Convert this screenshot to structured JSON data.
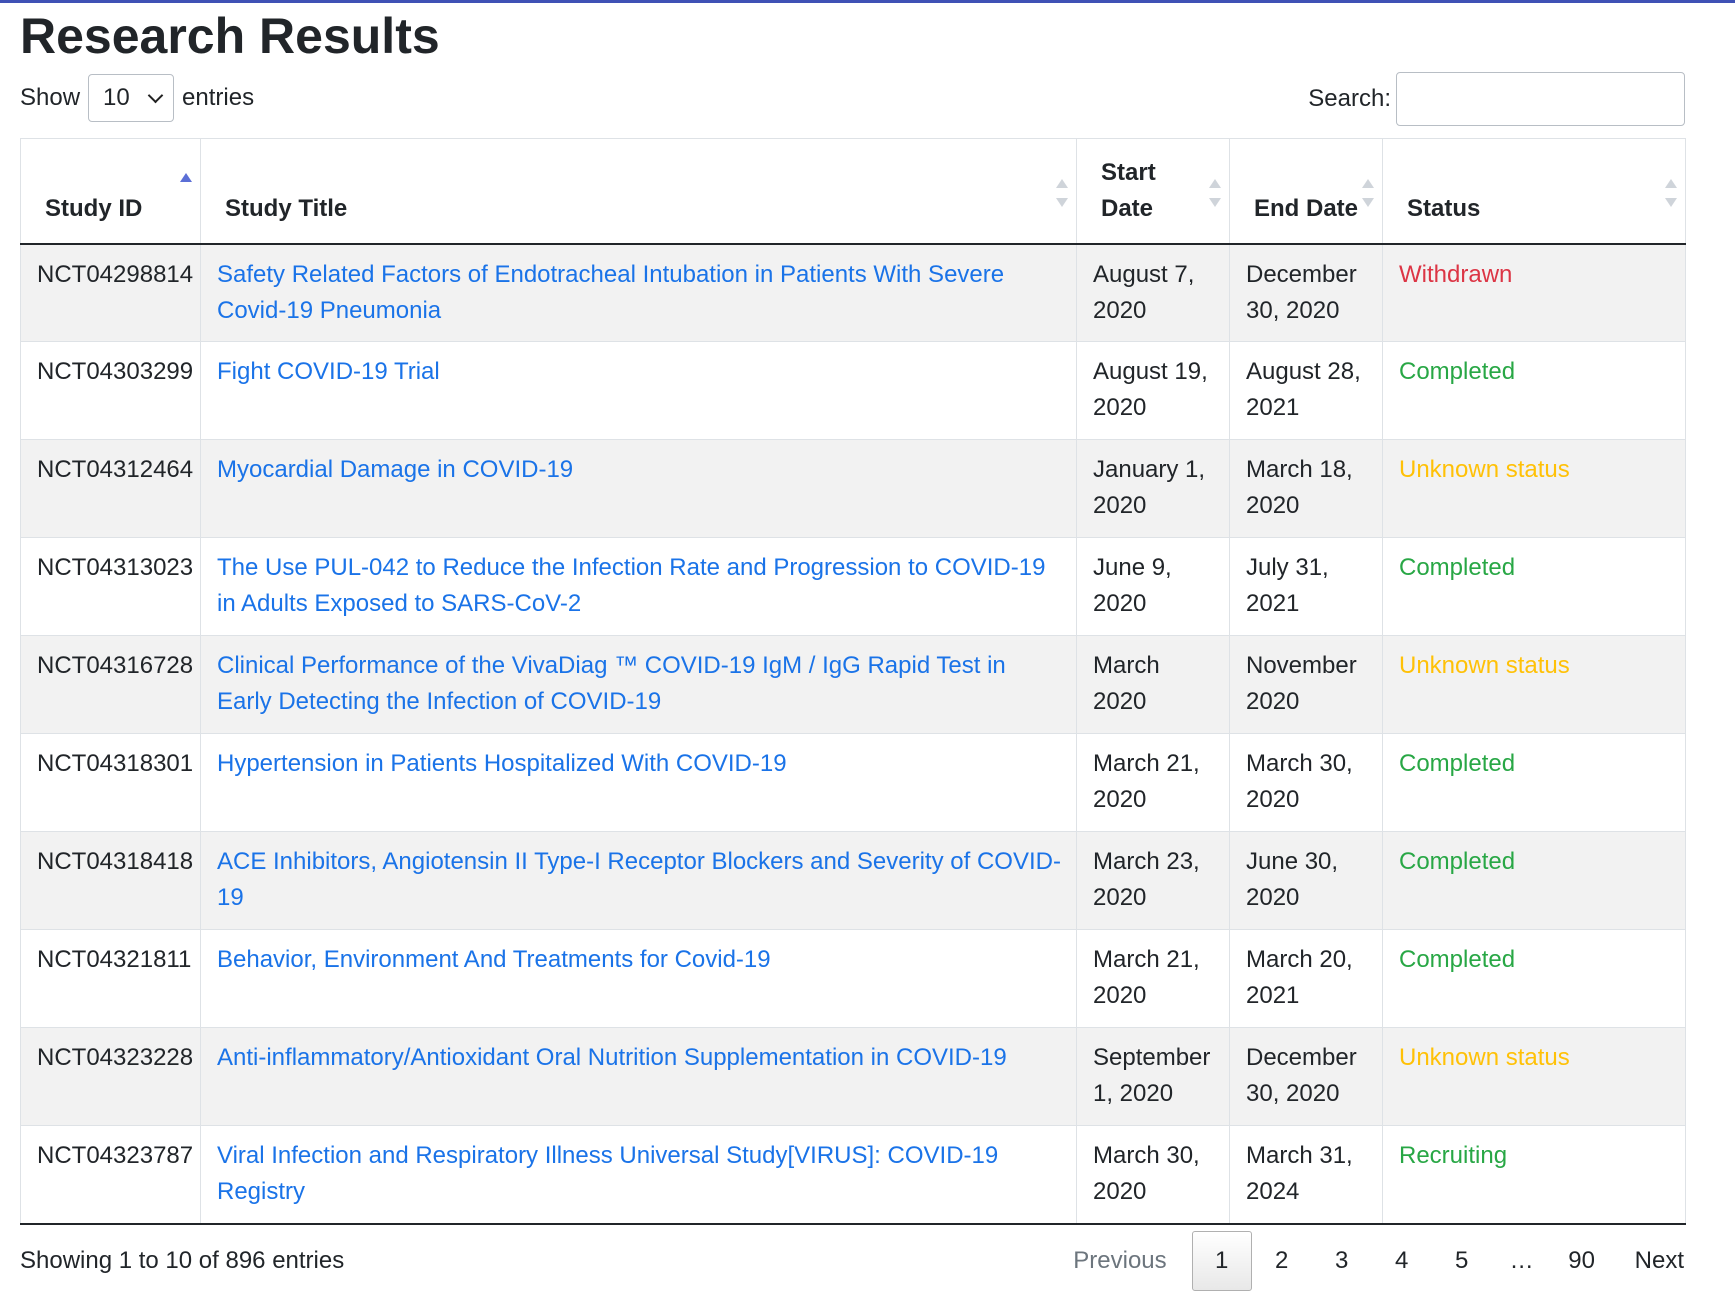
{
  "page": {
    "title": "Research Results"
  },
  "controls": {
    "show_label": "Show",
    "entries_label": "entries",
    "page_size": "10",
    "search_label": "Search:",
    "search_value": ""
  },
  "table": {
    "columns": [
      {
        "label": "Study ID",
        "sort": "asc"
      },
      {
        "label": "Study Title",
        "sort": "none"
      },
      {
        "label": "Start Date",
        "sort": "none"
      },
      {
        "label": "End Date",
        "sort": "none"
      },
      {
        "label": "Status",
        "sort": "none"
      }
    ],
    "rows": [
      {
        "study_id": "NCT04298814",
        "title": "Safety Related Factors of Endotracheal Intubation in Patients With Severe Covid-19 Pneumonia",
        "start_date": "August 7, 2020",
        "end_date": "December 30, 2020",
        "status": "Withdrawn"
      },
      {
        "study_id": "NCT04303299",
        "title": "Fight COVID-19 Trial",
        "start_date": "August 19, 2020",
        "end_date": "August 28, 2021",
        "status": "Completed"
      },
      {
        "study_id": "NCT04312464",
        "title": "Myocardial Damage in COVID-19",
        "start_date": "January 1, 2020",
        "end_date": "March 18, 2020",
        "status": "Unknown status"
      },
      {
        "study_id": "NCT04313023",
        "title": "The Use PUL-042 to Reduce the Infection Rate and Progression to COVID-19 in Adults Exposed to SARS-CoV-2",
        "start_date": "June 9, 2020",
        "end_date": "July 31, 2021",
        "status": "Completed"
      },
      {
        "study_id": "NCT04316728",
        "title": "Clinical Performance of the VivaDiag ™ COVID-19 IgM / IgG Rapid Test in Early Detecting the Infection of COVID-19",
        "start_date": "March 2020",
        "end_date": "November 2020",
        "status": "Unknown status"
      },
      {
        "study_id": "NCT04318301",
        "title": "Hypertension in Patients Hospitalized With COVID-19",
        "start_date": "March 21, 2020",
        "end_date": "March 30, 2020",
        "status": "Completed"
      },
      {
        "study_id": "NCT04318418",
        "title": "ACE Inhibitors, Angiotensin II Type-I Receptor Blockers and Severity of COVID-19",
        "start_date": "March 23, 2020",
        "end_date": "June 30, 2020",
        "status": "Completed"
      },
      {
        "study_id": "NCT04321811",
        "title": "Behavior, Environment And Treatments for Covid-19",
        "start_date": "March 21, 2020",
        "end_date": "March 20, 2021",
        "status": "Completed"
      },
      {
        "study_id": "NCT04323228",
        "title": "Anti-inflammatory/Antioxidant Oral Nutrition Supplementation in COVID-19",
        "start_date": "September 1, 2020",
        "end_date": "December 30, 2020",
        "status": "Unknown status"
      },
      {
        "study_id": "NCT04323787",
        "title": "Viral Infection and Respiratory Illness Universal Study[VIRUS]: COVID-19 Registry",
        "start_date": "March 30, 2020",
        "end_date": "March 31, 2024",
        "status": "Recruiting"
      }
    ]
  },
  "footer": {
    "info": "Showing 1 to 10 of 896 entries"
  },
  "pagination": {
    "previous": "Previous",
    "pages": [
      "1",
      "2",
      "3",
      "4",
      "5",
      "…",
      "90"
    ],
    "current": "1",
    "next": "Next"
  },
  "colors": {
    "top_rule": "#3f51b5",
    "link": "#1a73e8",
    "withdrawn": "#dc3545",
    "completed": "#28a745",
    "unknown": "#ffc107",
    "recruiting": "#28a745"
  }
}
